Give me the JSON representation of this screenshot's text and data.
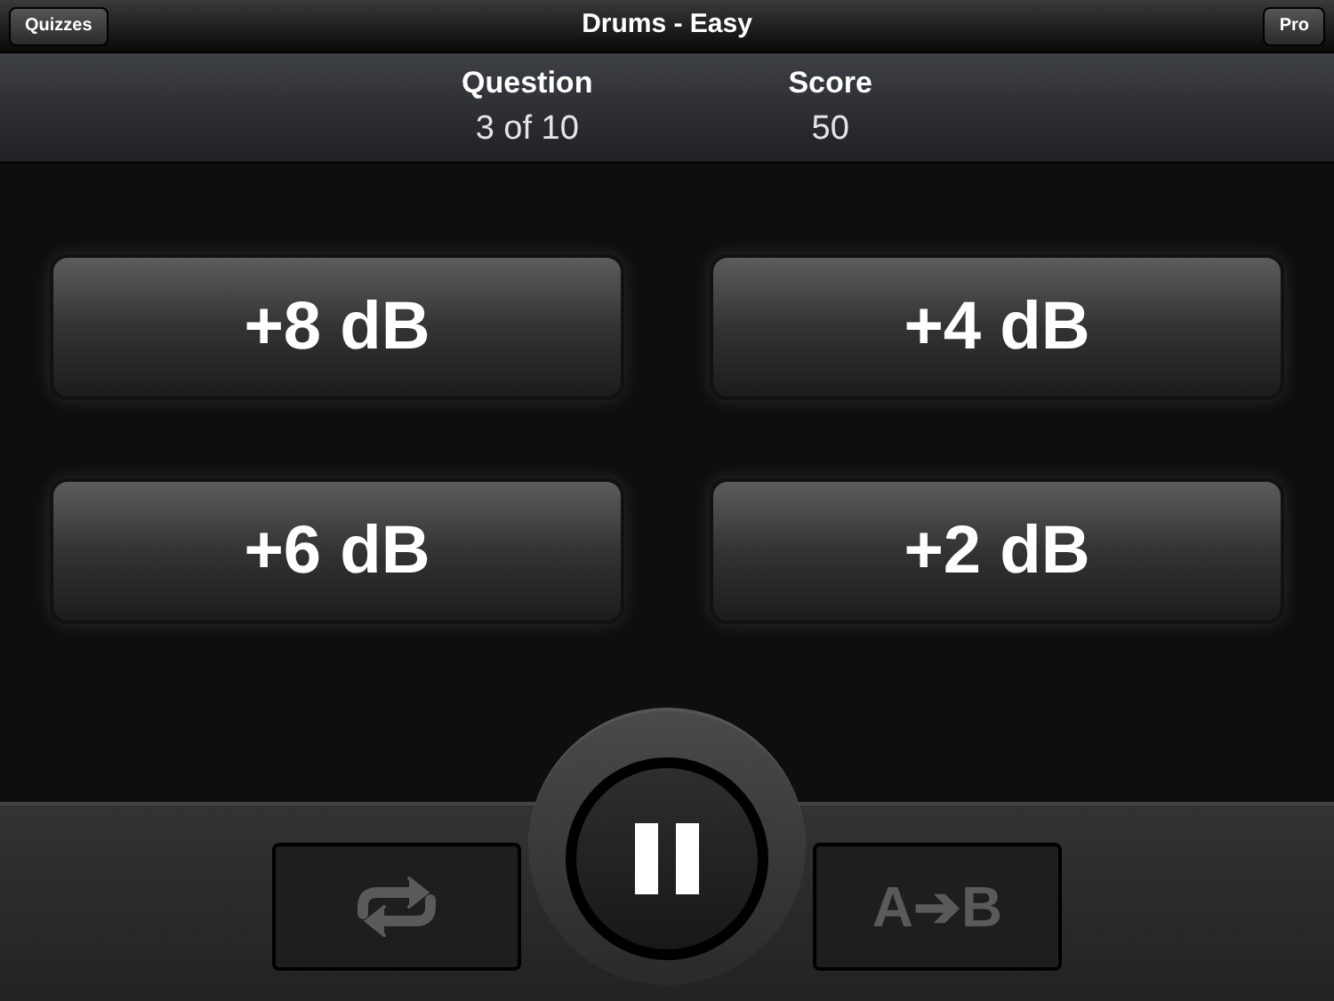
{
  "nav_bar": {
    "back_button": "Quizzes",
    "title": "Drums - Easy",
    "right_button": "Pro"
  },
  "stats": [
    {
      "label": "Question",
      "value": "3 of 10"
    },
    {
      "label": "Score",
      "value": "50"
    }
  ],
  "answers": [
    "+8 dB",
    "+4 dB",
    "+6 dB",
    "+2 dB"
  ],
  "controls": {
    "loop": {
      "disabled": true
    },
    "playback": {
      "playing": true
    },
    "ab_switch": {
      "label": "A➔B",
      "disabled": true
    }
  }
}
